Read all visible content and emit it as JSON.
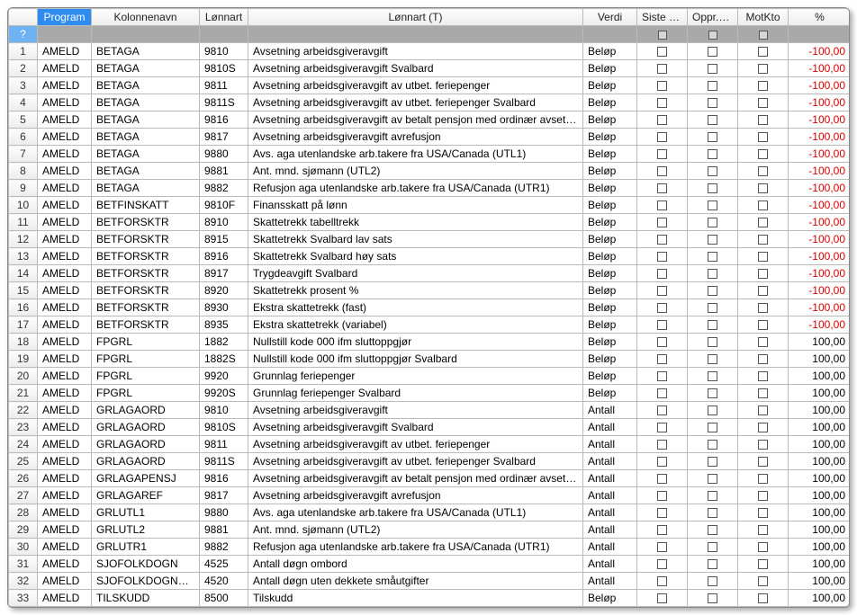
{
  "headers": {
    "rownum": "",
    "program": "Program",
    "kolonnenavn": "Kolonnenavn",
    "lonnart": "Lønnart",
    "lonnart_t": "Lønnart (T)",
    "verdi": "Verdi",
    "siste_per": "Siste per.",
    "oppr_per": "Oppr.per",
    "motkto": "MotKto",
    "pct": "%"
  },
  "filter_label": "?",
  "rows": [
    {
      "n": "1",
      "program": "AMELD",
      "kol": "BETAGA",
      "lonnart": "9810",
      "txt": "Avsetning arbeidsgiveravgift",
      "verdi": "Beløp",
      "pct": "-100,00",
      "neg": true
    },
    {
      "n": "2",
      "program": "AMELD",
      "kol": "BETAGA",
      "lonnart": "9810S",
      "txt": "Avsetning arbeidsgiveravgift Svalbard",
      "verdi": "Beløp",
      "pct": "-100,00",
      "neg": true
    },
    {
      "n": "3",
      "program": "AMELD",
      "kol": "BETAGA",
      "lonnart": "9811",
      "txt": "Avsetning arbeidsgiveravgift av utbet. feriepenger",
      "verdi": "Beløp",
      "pct": "-100,00",
      "neg": true
    },
    {
      "n": "4",
      "program": "AMELD",
      "kol": "BETAGA",
      "lonnart": "9811S",
      "txt": "Avsetning arbeidsgiveravgift av utbet. feriepenger Svalbard",
      "verdi": "Beløp",
      "pct": "-100,00",
      "neg": true
    },
    {
      "n": "5",
      "program": "AMELD",
      "kol": "BETAGA",
      "lonnart": "9816",
      "txt": "Avsetning arbeidsgiveravgift av betalt pensjon med ordinær avsetning",
      "verdi": "Beløp",
      "pct": "-100,00",
      "neg": true
    },
    {
      "n": "6",
      "program": "AMELD",
      "kol": "BETAGA",
      "lonnart": "9817",
      "txt": "Avsetning arbeidsgiveravgift avrefusjon",
      "verdi": "Beløp",
      "pct": "-100,00",
      "neg": true
    },
    {
      "n": "7",
      "program": "AMELD",
      "kol": "BETAGA",
      "lonnart": "9880",
      "txt": "Avs. aga utenlandske arb.takere fra USA/Canada (UTL1)",
      "verdi": "Beløp",
      "pct": "-100,00",
      "neg": true
    },
    {
      "n": "8",
      "program": "AMELD",
      "kol": "BETAGA",
      "lonnart": "9881",
      "txt": "Ant. mnd. sjømann (UTL2)",
      "verdi": "Beløp",
      "pct": "-100,00",
      "neg": true
    },
    {
      "n": "9",
      "program": "AMELD",
      "kol": "BETAGA",
      "lonnart": "9882",
      "txt": "Refusjon aga utenlandske arb.takere fra USA/Canada (UTR1)",
      "verdi": "Beløp",
      "pct": "-100,00",
      "neg": true
    },
    {
      "n": "10",
      "program": "AMELD",
      "kol": "BETFINSKATT",
      "lonnart": "9810F",
      "txt": "Finansskatt på lønn",
      "verdi": "Beløp",
      "pct": "-100,00",
      "neg": true
    },
    {
      "n": "11",
      "program": "AMELD",
      "kol": "BETFORSKTR",
      "lonnart": "8910",
      "txt": "Skattetrekk tabelltrekk",
      "verdi": "Beløp",
      "pct": "-100,00",
      "neg": true
    },
    {
      "n": "12",
      "program": "AMELD",
      "kol": "BETFORSKTR",
      "lonnart": "8915",
      "txt": "Skattetrekk Svalbard lav sats",
      "verdi": "Beløp",
      "pct": "-100,00",
      "neg": true
    },
    {
      "n": "13",
      "program": "AMELD",
      "kol": "BETFORSKTR",
      "lonnart": "8916",
      "txt": "Skattetrekk Svalbard høy sats",
      "verdi": "Beløp",
      "pct": "-100,00",
      "neg": true
    },
    {
      "n": "14",
      "program": "AMELD",
      "kol": "BETFORSKTR",
      "lonnart": "8917",
      "txt": "Trygdeavgift Svalbard",
      "verdi": "Beløp",
      "pct": "-100,00",
      "neg": true
    },
    {
      "n": "15",
      "program": "AMELD",
      "kol": "BETFORSKTR",
      "lonnart": "8920",
      "txt": "Skattetrekk prosent %",
      "verdi": "Beløp",
      "pct": "-100,00",
      "neg": true
    },
    {
      "n": "16",
      "program": "AMELD",
      "kol": "BETFORSKTR",
      "lonnart": "8930",
      "txt": "Ekstra skattetrekk (fast)",
      "verdi": "Beløp",
      "pct": "-100,00",
      "neg": true
    },
    {
      "n": "17",
      "program": "AMELD",
      "kol": "BETFORSKTR",
      "lonnart": "8935",
      "txt": "Ekstra skattetrekk (variabel)",
      "verdi": "Beløp",
      "pct": "-100,00",
      "neg": true
    },
    {
      "n": "18",
      "program": "AMELD",
      "kol": "FPGRL",
      "lonnart": "1882",
      "txt": "Nullstill kode 000 ifm sluttoppgjør",
      "verdi": "Beløp",
      "pct": "100,00",
      "neg": false
    },
    {
      "n": "19",
      "program": "AMELD",
      "kol": "FPGRL",
      "lonnart": "1882S",
      "txt": "Nullstill kode 000 ifm sluttoppgjør Svalbard",
      "verdi": "Beløp",
      "pct": "100,00",
      "neg": false
    },
    {
      "n": "20",
      "program": "AMELD",
      "kol": "FPGRL",
      "lonnart": "9920",
      "txt": "Grunnlag feriepenger",
      "verdi": "Beløp",
      "pct": "100,00",
      "neg": false
    },
    {
      "n": "21",
      "program": "AMELD",
      "kol": "FPGRL",
      "lonnart": "9920S",
      "txt": "Grunnlag feriepenger Svalbard",
      "verdi": "Beløp",
      "pct": "100,00",
      "neg": false
    },
    {
      "n": "22",
      "program": "AMELD",
      "kol": "GRLAGAORD",
      "lonnart": "9810",
      "txt": "Avsetning arbeidsgiveravgift",
      "verdi": "Antall",
      "pct": "100,00",
      "neg": false
    },
    {
      "n": "23",
      "program": "AMELD",
      "kol": "GRLAGAORD",
      "lonnart": "9810S",
      "txt": "Avsetning arbeidsgiveravgift Svalbard",
      "verdi": "Antall",
      "pct": "100,00",
      "neg": false
    },
    {
      "n": "24",
      "program": "AMELD",
      "kol": "GRLAGAORD",
      "lonnart": "9811",
      "txt": "Avsetning arbeidsgiveravgift av utbet. feriepenger",
      "verdi": "Antall",
      "pct": "100,00",
      "neg": false
    },
    {
      "n": "25",
      "program": "AMELD",
      "kol": "GRLAGAORD",
      "lonnart": "9811S",
      "txt": "Avsetning arbeidsgiveravgift av utbet. feriepenger Svalbard",
      "verdi": "Antall",
      "pct": "100,00",
      "neg": false
    },
    {
      "n": "26",
      "program": "AMELD",
      "kol": "GRLAGAPENSJ",
      "lonnart": "9816",
      "txt": "Avsetning arbeidsgiveravgift av betalt pensjon med ordinær avsetning",
      "verdi": "Antall",
      "pct": "100,00",
      "neg": false
    },
    {
      "n": "27",
      "program": "AMELD",
      "kol": "GRLAGAREF",
      "lonnart": "9817",
      "txt": "Avsetning arbeidsgiveravgift avrefusjon",
      "verdi": "Antall",
      "pct": "100,00",
      "neg": false
    },
    {
      "n": "28",
      "program": "AMELD",
      "kol": "GRLUTL1",
      "lonnart": "9880",
      "txt": "Avs. aga utenlandske arb.takere fra USA/Canada (UTL1)",
      "verdi": "Antall",
      "pct": "100,00",
      "neg": false
    },
    {
      "n": "29",
      "program": "AMELD",
      "kol": "GRLUTL2",
      "lonnart": "9881",
      "txt": "Ant. mnd. sjømann (UTL2)",
      "verdi": "Antall",
      "pct": "100,00",
      "neg": false
    },
    {
      "n": "30",
      "program": "AMELD",
      "kol": "GRLUTR1",
      "lonnart": "9882",
      "txt": "Refusjon aga utenlandske arb.takere fra USA/Canada (UTR1)",
      "verdi": "Antall",
      "pct": "100,00",
      "neg": false
    },
    {
      "n": "31",
      "program": "AMELD",
      "kol": "SJOFOLKDOGN",
      "lonnart": "4525",
      "txt": "Antall døgn ombord",
      "verdi": "Antall",
      "pct": "100,00",
      "neg": false
    },
    {
      "n": "32",
      "program": "AMELD",
      "kol": "SJOFOLKDOGNUTEN",
      "lonnart": "4520",
      "txt": "Antall døgn uten dekkete småutgifter",
      "verdi": "Antall",
      "pct": "100,00",
      "neg": false
    },
    {
      "n": "33",
      "program": "AMELD",
      "kol": "TILSKUDD",
      "lonnart": "8500",
      "txt": "Tilskudd",
      "verdi": "Beløp",
      "pct": "100,00",
      "neg": false
    }
  ]
}
